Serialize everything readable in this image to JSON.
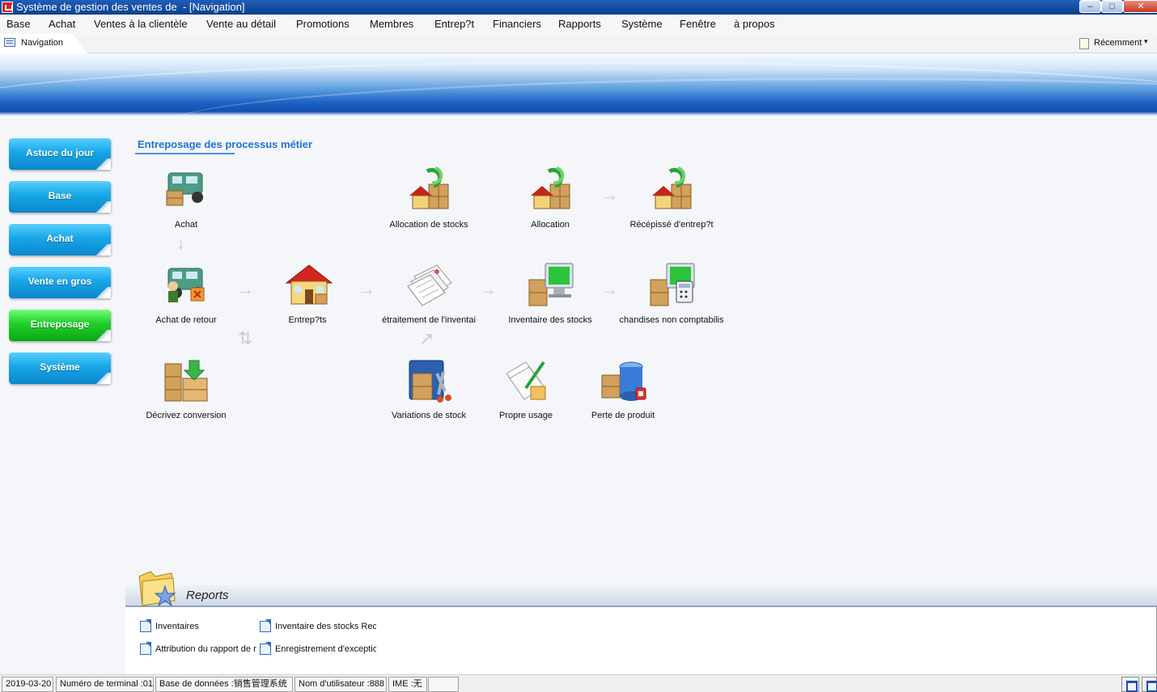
{
  "window": {
    "title": "Système de gestion des ventes de  - [Navigation]",
    "controls": {
      "minimize": "–",
      "maximize": "□",
      "close": "✕"
    }
  },
  "menu": [
    "Base",
    "Achat",
    "Ventes à la clientèle",
    "Vente au détail",
    "Promotions",
    "Membres",
    "Entrep?t",
    "Financiers",
    "Rapports",
    "Système",
    "Fenêtre",
    "à propos"
  ],
  "doc_tab": {
    "label": "Navigation",
    "icon": "window-icon"
  },
  "recent": {
    "label": "Récemment",
    "arrow": "▾",
    "icon": "recent-docs-icon"
  },
  "sidebar": {
    "items": [
      "Astuce du jour",
      "Base",
      "Achat",
      "Vente en gros",
      "Entreposage",
      "Système"
    ],
    "active": "Entreposage"
  },
  "workflow": {
    "title": "Entreposage des processus métier",
    "nodes": {
      "achat": {
        "label": "Achat",
        "icon": "truck-icon"
      },
      "alloc_stocks": {
        "label": "Allocation de stocks",
        "icon": "house-transfer-icon"
      },
      "allocation": {
        "label": "Allocation",
        "icon": "house-transfer-icon"
      },
      "recepisse": {
        "label": "Récépissé d'entrep?t",
        "icon": "house-transfer-icon"
      },
      "achat_retour": {
        "label": "Achat de retour",
        "icon": "truck-return-icon"
      },
      "entrepots": {
        "label": "Entrep?ts",
        "icon": "warehouse-icon"
      },
      "retraitement": {
        "label": "étraitement de l'inventai",
        "icon": "documents-stack-icon"
      },
      "inventaire": {
        "label": "Inventaire des stocks",
        "icon": "boxes-monitor-icon"
      },
      "marchandises": {
        "label": "chandises non comptabilis",
        "icon": "boxes-monitor-calculator-icon"
      },
      "conversion": {
        "label": "Décrivez conversion",
        "icon": "boxes-download-icon"
      },
      "variations": {
        "label": "Variations de stock",
        "icon": "boxes-tools-icon"
      },
      "propre_usage": {
        "label": "Propre usage",
        "icon": "papers-pen-icon"
      },
      "perte": {
        "label": "Perte de produit",
        "icon": "boxes-database-icon"
      }
    }
  },
  "reports": {
    "title": "Reports",
    "links": [
      "Inventaires",
      "Inventaire des stocks Rec",
      "Attribution du rapport de r",
      "Enregistrement d'exceptio"
    ]
  },
  "status": {
    "date": "2019-03-20",
    "terminal": "Numéro de terminal :01",
    "database": "Base de données :销售管理系统",
    "user": "Nom d'utilisateur :888",
    "ime": "IME :无"
  },
  "colors": {
    "accent": "#1f73d6",
    "sidebar_blue": "#18a7e8",
    "sidebar_active": "#21d02a"
  }
}
